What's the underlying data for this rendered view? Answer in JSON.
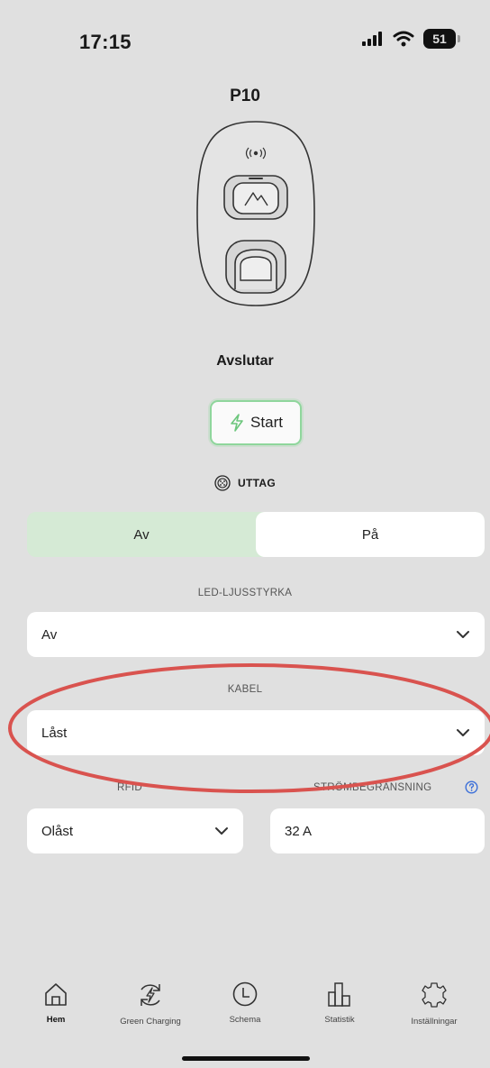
{
  "status_bar": {
    "time": "17:15",
    "battery": "51"
  },
  "device": {
    "name": "P10"
  },
  "state": "Avslutar",
  "start_button": "Start",
  "outlet": {
    "label": "UTTAG",
    "options": [
      "Av",
      "På"
    ],
    "selected": "Av"
  },
  "led": {
    "label": "LED-LJUSSTYRKA",
    "value": "Av"
  },
  "cable": {
    "label": "KABEL",
    "value": "Låst"
  },
  "rfid": {
    "label": "RFID",
    "value": "Olåst"
  },
  "current_limit": {
    "label": "STRÖMBEGRÄNSNING",
    "value": "32 A"
  },
  "nav": [
    {
      "label": "Hem",
      "icon": "home-icon",
      "active": true
    },
    {
      "label": "Green Charging",
      "icon": "green-charging-icon",
      "active": false
    },
    {
      "label": "Schema",
      "icon": "clock-icon",
      "active": false
    },
    {
      "label": "Statistik",
      "icon": "bar-chart-icon",
      "active": false
    },
    {
      "label": "Inställningar",
      "icon": "gear-icon",
      "active": false
    }
  ],
  "colors": {
    "accent_green": "#8fd69c",
    "toggle_bg": "#d5ead5",
    "annotation_red": "#d9534f",
    "info_blue": "#3b6fd9"
  }
}
